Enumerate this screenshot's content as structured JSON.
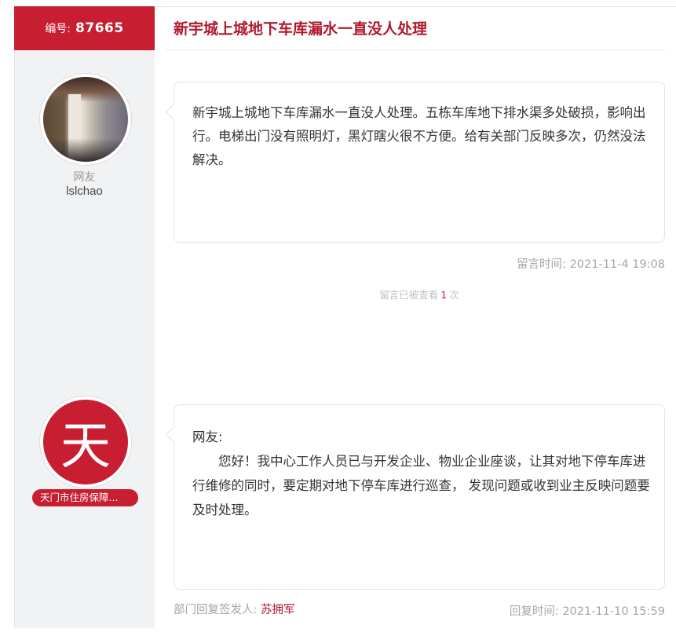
{
  "header": {
    "number_label": "编号:",
    "number_value": "87665",
    "title": "新宇城上城地下车库漏水一直没人处理"
  },
  "user": {
    "role": "网友",
    "name": "lslchao",
    "avatar": "photo-avatar"
  },
  "message": {
    "text": "新宇城上城地下车库漏水一直没人处理。五栋车库地下排水渠多处破损，影响出行。电梯出门没有照明灯，黑灯瞎火很不方便。给有关部门反映多次，仍然没法解决。",
    "time_label": "留言时间:",
    "time_value": "2021-11-4 19:08",
    "views_prefix": "留言已被查看",
    "views_count": "1",
    "views_suffix": "次"
  },
  "reply": {
    "avatar_char": "天",
    "department": "天门市住房保障...",
    "greeting": "网友:",
    "text": "您好！我中心工作人员已与开发企业、物业企业座谈，让其对地下停车库进行维修的同时，要定期对地下停车库进行巡查， 发现问题或收到业主反映问题要及时处理。",
    "signer_label": "部门回复签发人:",
    "signer_name": "苏拥军",
    "time_label": "回复时间:",
    "time_value": "2021-11-10 15:59"
  },
  "colors": {
    "brand_red": "#c81e32",
    "title_red": "#b0182d",
    "sidebar_bg": "#f1f2f4"
  }
}
